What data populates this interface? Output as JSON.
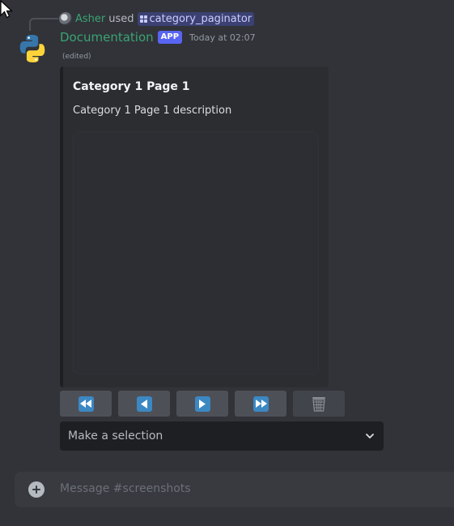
{
  "reply": {
    "username": "Asher",
    "used_text": "used",
    "command": "category_paginator"
  },
  "message": {
    "author": "Documentation",
    "badge": "APP",
    "timestamp": "Today at 02:07",
    "edited": "(edited)"
  },
  "embed": {
    "title": "Category 1 Page 1",
    "description": "Category 1 Page 1 description"
  },
  "buttons": [
    {
      "icon": "rewind-icon"
    },
    {
      "icon": "arrow-left-icon"
    },
    {
      "icon": "arrow-right-icon"
    },
    {
      "icon": "fast-forward-icon"
    },
    {
      "icon": "wastebasket-icon"
    }
  ],
  "select": {
    "placeholder": "Make a selection",
    "icon": "chevron-down-icon"
  },
  "composer": {
    "placeholder": "Message #screenshots"
  },
  "colors": {
    "background": "#313338",
    "username": "#3aa373",
    "badge": "#5865f2",
    "button": "#4e5058",
    "emoji_blue": "#3b88c3"
  }
}
